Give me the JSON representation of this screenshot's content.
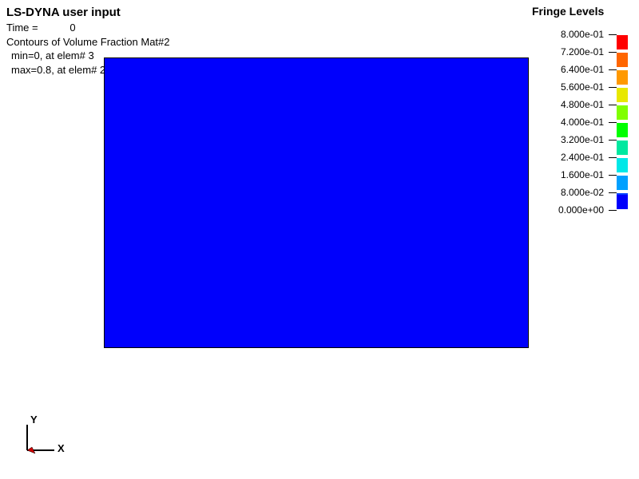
{
  "header": {
    "title": "LS-DYNA user input",
    "time_label": "Time =",
    "time_value": "0",
    "contour": "Contours of Volume Fraction Mat#2",
    "min": "min=0, at elem# 3",
    "max": "max=0.8, at elem# 2"
  },
  "fringe": {
    "title": "Fringe Levels",
    "levels": [
      {
        "value": "8.000e-01",
        "color": "#ff0000"
      },
      {
        "value": "7.200e-01",
        "color": "#ff6600"
      },
      {
        "value": "6.400e-01",
        "color": "#ff9900"
      },
      {
        "value": "5.600e-01",
        "color": "#e8e800"
      },
      {
        "value": "4.800e-01",
        "color": "#80ff00"
      },
      {
        "value": "4.000e-01",
        "color": "#00ff00"
      },
      {
        "value": "3.200e-01",
        "color": "#00e8a0"
      },
      {
        "value": "2.400e-01",
        "color": "#00e8e8"
      },
      {
        "value": "1.600e-01",
        "color": "#00a0ff"
      },
      {
        "value": "8.000e-02",
        "color": "#0040ff"
      },
      {
        "value": "0.000e+00",
        "color": "#0000fc"
      }
    ]
  },
  "triad": {
    "y": "Y",
    "x": "X"
  },
  "chart_data": {
    "type": "contour",
    "quantity": "Volume Fraction Mat#2",
    "time": 0,
    "min": {
      "value": 0,
      "element": 3
    },
    "max": {
      "value": 0.8,
      "element": 2
    },
    "colormap_range": [
      0.0,
      0.8
    ],
    "displayed_field": "uniform",
    "displayed_value": 0.0
  }
}
